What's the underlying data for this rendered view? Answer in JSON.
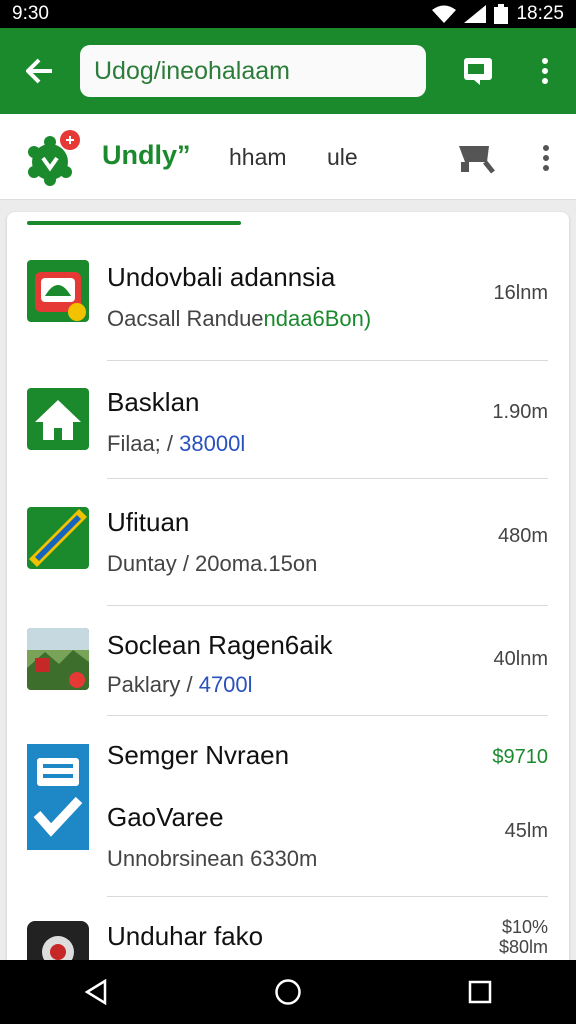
{
  "status_bar": {
    "time_left": "9:30",
    "time_right": "18:25"
  },
  "browser": {
    "url": "Udog/ineohalaam"
  },
  "site": {
    "name": "Undly”",
    "nav": [
      "hham",
      "ule"
    ]
  },
  "items": [
    {
      "title": "Undovbali adannsia",
      "sub_plain": "Oacsall Randue",
      "sub_hl": "ndaa6Bon)",
      "meta": "16lnm",
      "thumb": "app-badge-icon"
    },
    {
      "title": "Basklan",
      "sub_plain": "Filaa; / ",
      "sub_hl": "38000l",
      "meta": "1.90m",
      "thumb": "house-icon"
    },
    {
      "title": "Ufituan",
      "sub_plain": "Duntay / 20oma.15on",
      "sub_hl": "",
      "meta": "480m",
      "thumb": "ticket-icon"
    },
    {
      "title": "Soclean Ragen6aik",
      "sub_plain": "Paklary / ",
      "sub_hl": "4700l",
      "meta": "40lnm",
      "thumb": "photo-thumbnail"
    },
    {
      "title": "Semger Nvraen",
      "title2": "GaoVaree",
      "sub_plain": "Unnobrsinean 6330m",
      "sub_hl": "",
      "meta": "45lm",
      "meta_top": "$9710",
      "thumb": "checklist-icon"
    },
    {
      "title": "Unduhar fako",
      "meta": "$10%",
      "meta2": "$80lm",
      "thumb": "app-circle-icon"
    }
  ],
  "colors": {
    "brand": "#1b8a2d",
    "link_blue": "#2a52be"
  }
}
